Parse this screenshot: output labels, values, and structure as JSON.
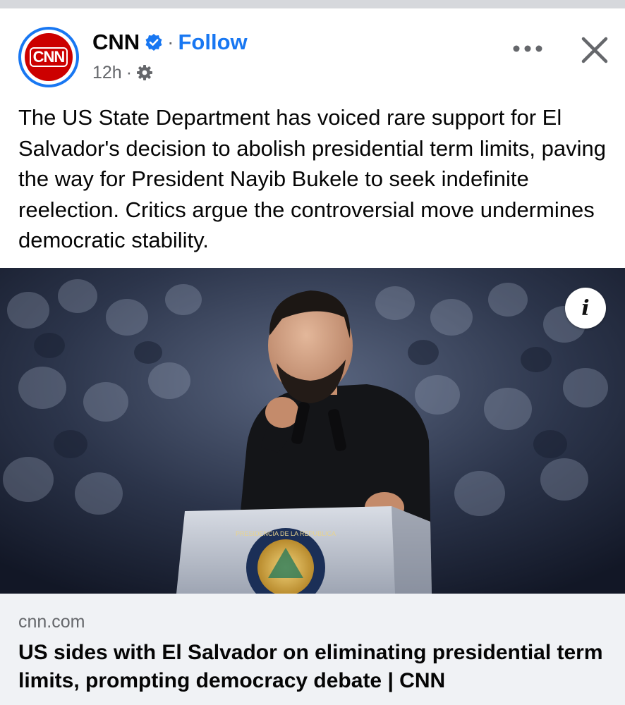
{
  "post": {
    "page_name": "CNN",
    "avatar_text": "CNN",
    "follow_label": "Follow",
    "separator": "·",
    "timestamp": "12h",
    "meta_separator": "·",
    "body_text": "The US State Department has voiced rare support for El Salvador's decision to abolish presidential term limits, paving the way for President Nayib Bukele to seek indefinite reelection. Critics argue the controversial move undermines democratic stability.",
    "verified": true,
    "icons": {
      "verified": "verified-badge-icon",
      "audience": "gear-icon",
      "more": "more-dots-icon",
      "close": "close-icon",
      "info": "info-icon"
    },
    "colors": {
      "accent": "#1877f2",
      "brand": "#cc0000",
      "card_bg": "#f0f2f5",
      "secondary_text": "#65676b"
    }
  },
  "image": {
    "info_label": "i",
    "seal_text": "PRESIDENCIA DE LA REPUBLICA"
  },
  "link_card": {
    "domain": "cnn.com",
    "title": "US sides with El Salvador on eliminating presidential term limits, prompting democracy debate | CNN"
  }
}
